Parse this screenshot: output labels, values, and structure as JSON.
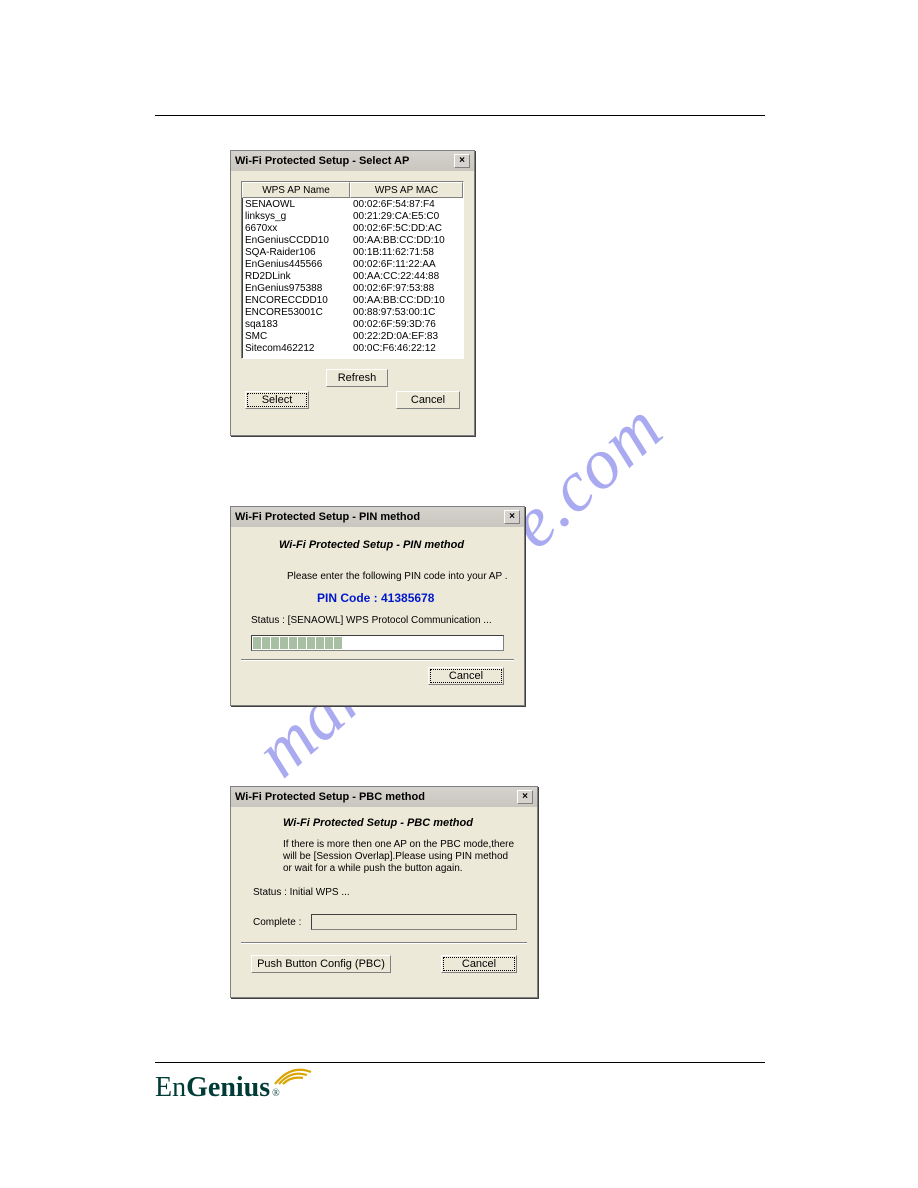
{
  "watermark": "manualshive.com",
  "dlg1": {
    "title": "Wi-Fi Protected Setup - Select AP",
    "col_name": "WPS AP Name",
    "col_mac": "WPS AP MAC",
    "rows": [
      {
        "name": "SENAOWL",
        "mac": "00:02:6F:54:87:F4"
      },
      {
        "name": "linksys_g",
        "mac": "00:21:29:CA:E5:C0"
      },
      {
        "name": "6670xx",
        "mac": "00:02:6F:5C:DD:AC"
      },
      {
        "name": "EnGeniusCCDD10",
        "mac": "00:AA:BB:CC:DD:10"
      },
      {
        "name": "SQA-Raider106",
        "mac": "00:1B:11:62:71:58"
      },
      {
        "name": "EnGenius445566",
        "mac": "00:02:6F:11:22:AA"
      },
      {
        "name": "RD2DLink",
        "mac": "00:AA:CC:22:44:88"
      },
      {
        "name": "EnGenius975388",
        "mac": "00:02:6F:97:53:88"
      },
      {
        "name": "ENCORECCDD10",
        "mac": "00:AA:BB:CC:DD:10"
      },
      {
        "name": "ENCORE53001C",
        "mac": "00:88:97:53:00:1C"
      },
      {
        "name": "sqa183",
        "mac": "00:02:6F:59:3D:76"
      },
      {
        "name": "SMC",
        "mac": "00:22:2D:0A:EF:83"
      },
      {
        "name": "Sitecom462212",
        "mac": "00:0C:F6:46:22:12"
      }
    ],
    "refresh": "Refresh",
    "select": "Select",
    "cancel": "Cancel"
  },
  "dlg2": {
    "title": "Wi-Fi Protected Setup - PIN method",
    "heading": "Wi-Fi Protected Setup - PIN method",
    "instruction": "Please enter the following PIN code into your AP .",
    "pin_label": "PIN Code :  41385678",
    "status": "Status :   [SENAOWL] WPS Protocol Communication ...",
    "cancel": "Cancel"
  },
  "dlg3": {
    "title": "Wi-Fi Protected Setup - PBC method",
    "heading": "Wi-Fi Protected Setup - PBC method",
    "note": "If there is more then one AP on the PBC mode,there will be [Session Overlap].Please using PIN method or wait for a while push the button again.",
    "status": "Status : Initial WPS ...",
    "complete_label": "Complete :",
    "pbc": "Push Button Config (PBC)",
    "cancel": "Cancel"
  },
  "logo": {
    "en": "En",
    "genius": "Genius",
    "reg": "®"
  }
}
